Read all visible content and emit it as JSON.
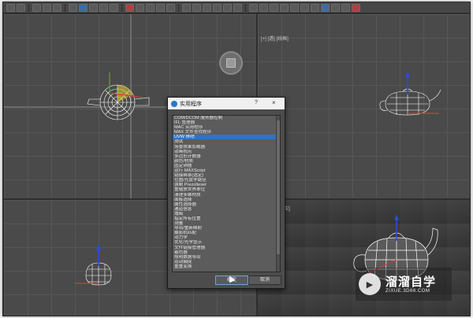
{
  "viewports": {
    "top_right_label": "[+] [透] [线框]",
    "bottom_right_label": "[+] [透] [真实]"
  },
  "dialog": {
    "title": "实用程序",
    "help": "?",
    "close": "×",
    "ok_label": "确定",
    "cancel_label": "取消",
    "items": [
      "COM/DCOM 服务器控制",
      "IFL 管理器",
      "MAC 实用程序",
      "MAX 文件查找程序",
      "UVW 移除",
      "测试",
      "场景效果加载器",
      "动画视点",
      "多边形计数器",
      "颜色/材质",
      "固定钟摆",
      "运行 MAXScript",
      "链接继承(选定)",
      "位图/光度学路径",
      "强制 Prezolteser",
      "重缩放世界单位",
      "清理多维材质",
      "面板选择",
      "属性选择器",
      "通道信息",
      "塌陷",
      "指定所有位置",
      "测量",
      "导出/重新映射",
      "摄影机匹配",
      "动力学",
      "优化/光学显示",
      "文件链接管理器",
      "着色器",
      "照明数据导出",
      "运动捕捉",
      "重置变换"
    ],
    "selected_index": 4
  },
  "watermark": {
    "title": "溜溜自学",
    "url": "ZIXUE.3D66.COM"
  },
  "colors": {
    "accent": "#2d73c8",
    "axis_x": "#d23c3c",
    "axis_y": "#3cb43c",
    "axis_z": "#2a4bd7"
  }
}
